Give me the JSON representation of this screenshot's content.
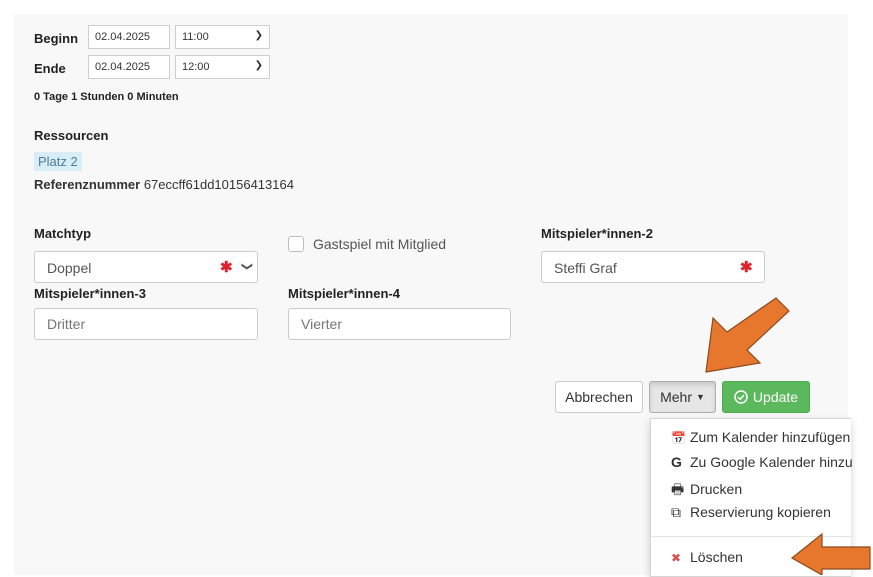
{
  "times": {
    "begin_label": "Beginn",
    "begin_date": "02.04.2025",
    "begin_time": "11:00",
    "end_label": "Ende",
    "end_date": "02.04.2025",
    "end_time": "12:00",
    "duration": "0 Tage 1 Stunden 0 Minuten"
  },
  "resources": {
    "heading": "Ressourcen",
    "badge": "Platz 2",
    "ref_label": "Referenznummer",
    "ref_value": "67eccff61dd10156413164"
  },
  "form": {
    "matchtyp_label": "Matchtyp",
    "matchtyp_value": "Doppel",
    "guest_label": "Gastspiel mit Mitglied",
    "p2_label": "Mitspieler*innen-2",
    "p2_value": "Steffi Graf",
    "p3_label": "Mitspieler*innen-3",
    "p3_placeholder": "Dritter",
    "p4_label": "Mitspieler*innen-4",
    "p4_placeholder": "Vierter",
    "required_mark": "✱"
  },
  "buttons": {
    "cancel": "Abbrechen",
    "more": "Mehr",
    "update": "Update"
  },
  "menu": {
    "items": [
      {
        "icon": "calendar-icon",
        "glyph": "📅",
        "label": "Zum Kalender hinzufügen"
      },
      {
        "icon": "google-icon",
        "glyph": "G",
        "label": "Zu Google Kalender hinzu"
      },
      {
        "icon": "print-icon",
        "glyph": "🖶",
        "label": "Drucken"
      },
      {
        "icon": "copy-icon",
        "glyph": "⧉",
        "label": "Reservierung kopieren"
      },
      {
        "icon": "delete-icon",
        "glyph": "✖",
        "label": "Löschen"
      }
    ]
  },
  "colors": {
    "accent_green": "#5cb85c",
    "badge_bg": "#d9edf7",
    "arrow_orange": "#e8772e",
    "required_red": "#e0202a"
  }
}
